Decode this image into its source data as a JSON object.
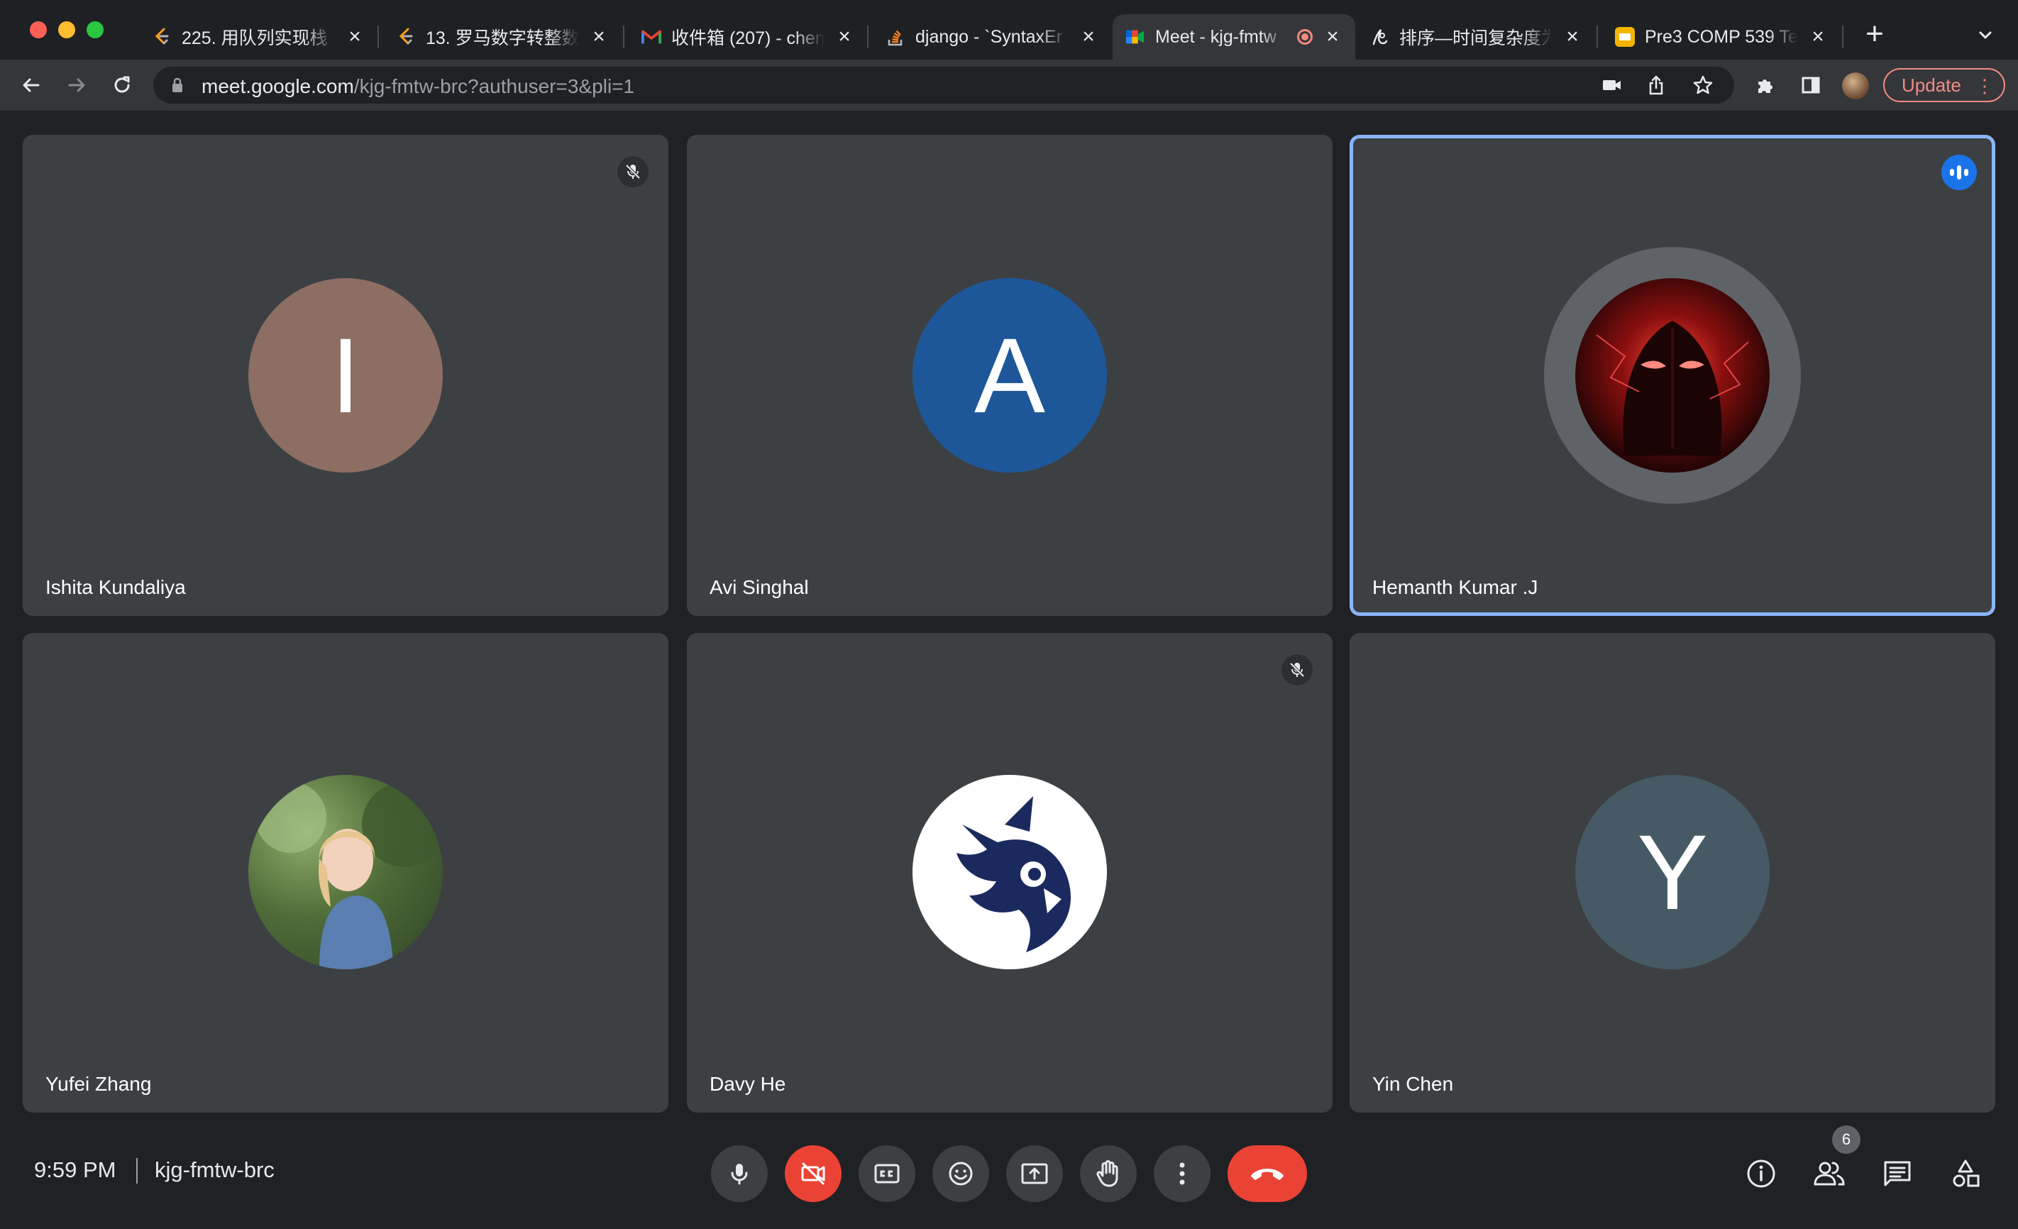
{
  "browser": {
    "tabs": [
      {
        "title": "225. 用队列实现栈 - ",
        "favicon": "leetcode-icon"
      },
      {
        "title": "13. 罗马数字转整数 ",
        "favicon": "leetcode-icon"
      },
      {
        "title": "收件箱 (207) - chen",
        "favicon": "gmail-icon"
      },
      {
        "title": "django - `SyntaxEr",
        "favicon": "stackoverflow-icon"
      },
      {
        "title": "Meet - kjg-fmtw",
        "favicon": "meet-icon",
        "active": true
      },
      {
        "title": "排序—时间复杂度为",
        "favicon": "zhihu-icon"
      },
      {
        "title": "Pre3 COMP 539 Te",
        "favicon": "slides-icon"
      }
    ],
    "url_host": "meet.google.com",
    "url_path": "/kjg-fmtw-brc?authuser=3&pli=1",
    "update_label": "Update"
  },
  "meeting": {
    "participants": [
      {
        "name": "Ishita Kundaliya",
        "initial": "I",
        "avatar_color": "#8d6e63",
        "muted": true
      },
      {
        "name": "Avi Singhal",
        "initial": "A",
        "avatar_color": "#1e5799",
        "muted": false
      },
      {
        "name": "Hemanth Kumar .J",
        "initial": "",
        "avatar_color": "#5a1010",
        "muted": false,
        "speaking": true
      },
      {
        "name": "Yufei Zhang",
        "initial": "",
        "avatar_color": "#5d7a4a",
        "muted": false
      },
      {
        "name": "Davy He",
        "initial": "",
        "avatar_color": "#ffffff",
        "muted": true
      },
      {
        "name": "Yin Chen",
        "initial": "Y",
        "avatar_color": "#455a64",
        "muted": false
      }
    ],
    "time": "9:59 PM",
    "code": "kjg-fmtw-brc",
    "people_count": "6"
  },
  "colors": {
    "background": "#202124",
    "tile": "#3c4043",
    "speaking_border": "#8ab4f8",
    "danger": "#ea4335"
  }
}
